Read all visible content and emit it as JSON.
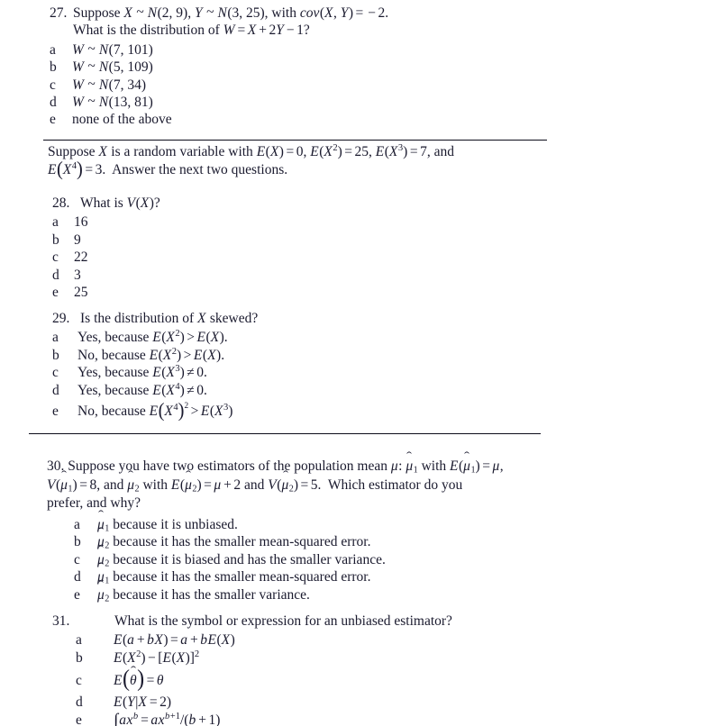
{
  "document": {
    "type": "exam-question-page",
    "page_background": "#ffffff",
    "text_color": "#1a1a2e",
    "rule_color": "#0d0d1a"
  },
  "questions": [
    {
      "number": "27.",
      "stem_lines": [
        "Suppose X ~ N(2, 9), Y ~ N(3, 25), with cov(X, Y) = - 2.",
        "What is the distribution of W = X + 2Y - 1?"
      ],
      "options": [
        {
          "label": "a",
          "text": "W ~ N(7, 101)"
        },
        {
          "label": "b",
          "text": "W ~ N(5, 109)"
        },
        {
          "label": "c",
          "text": "W ~ N(7, 34)"
        },
        {
          "label": "d",
          "text": "W ~ N(13, 81)"
        },
        {
          "label": "e",
          "text": "none of the above"
        }
      ]
    },
    {
      "number": "28.",
      "stem_lines": [
        "What is V(X)?"
      ],
      "options": [
        {
          "label": "a",
          "text": "16"
        },
        {
          "label": "b",
          "text": "9"
        },
        {
          "label": "c",
          "text": "22"
        },
        {
          "label": "d",
          "text": "3"
        },
        {
          "label": "e",
          "text": "25"
        }
      ]
    },
    {
      "number": "29.",
      "stem_lines": [
        "Is the distribution of X skewed?"
      ],
      "options": [
        {
          "label": "a",
          "text": "Yes, because E(X²) > E(X)."
        },
        {
          "label": "b",
          "text": "No, because E(X²) > E(X)."
        },
        {
          "label": "c",
          "text": "Yes, because E(X³) ≠ 0."
        },
        {
          "label": "d",
          "text": "Yes, because E(X⁴) ≠ 0."
        },
        {
          "label": "e",
          "text": "No, because E(X⁴)² > E(X³)"
        }
      ]
    },
    {
      "number": "30.",
      "stem_lines": [
        "Suppose you have two estimators of the population mean μ: μ̂1 with E(μ̂1) = μ,",
        "V(μ̂1) = 8, and μ̂2 with E(μ̂2) = μ + 2 and V(μ̂2) = 5. Which estimator do you",
        "prefer, and why?"
      ],
      "options": [
        {
          "label": "a",
          "text": "μ̂1 because it is unbiased."
        },
        {
          "label": "b",
          "text": "μ̂2 because it has the smaller mean-squared error."
        },
        {
          "label": "c",
          "text": "μ̂2 because it is biased and has the smaller variance."
        },
        {
          "label": "d",
          "text": "μ̂1 because it has the smaller mean-squared error."
        },
        {
          "label": "e",
          "text": "μ̂2 because it has the smaller variance."
        }
      ]
    },
    {
      "number": "31.",
      "stem_lines": [
        "What is the symbol or expression for an unbiased estimator?"
      ],
      "options": [
        {
          "label": "a",
          "text": "E(a + bX) = a + bE(X)"
        },
        {
          "label": "b",
          "text": "E(X²) − [E(X)]²"
        },
        {
          "label": "c",
          "text": "E(θ̂) = θ"
        },
        {
          "label": "d",
          "text": "E(Y|X = 2)"
        },
        {
          "label": "e",
          "text": "∫axᵇ = axᵇ⁺¹/(b + 1)"
        }
      ]
    }
  ],
  "preamble": {
    "lines": [
      "Suppose X is a random variable with E(X) = 0, E(X²) = 25, E(X³) = 7, and",
      "E(X⁴) = 3. Answer the next two questions."
    ]
  },
  "rules": [
    {
      "name": "rule-above-preamble"
    },
    {
      "name": "rule-below-question-29"
    }
  ]
}
